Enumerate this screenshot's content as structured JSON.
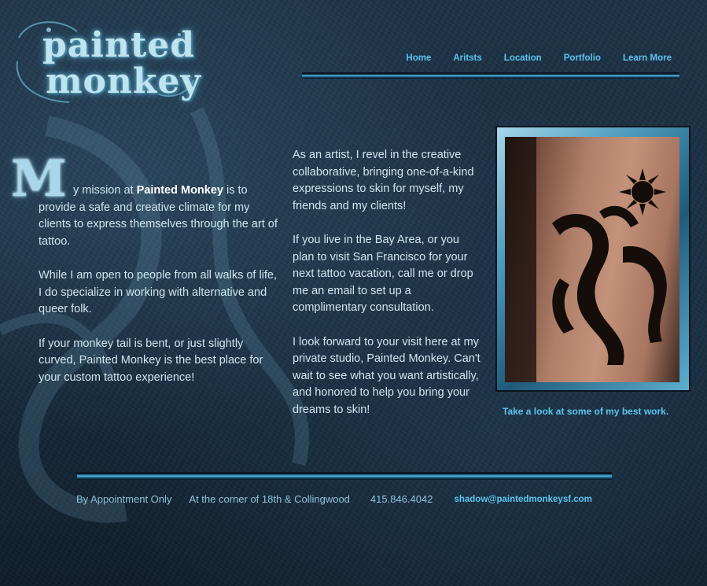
{
  "brand": {
    "logo_line1": "painted",
    "logo_line2": "monkey"
  },
  "nav": {
    "items": [
      "Home",
      "Aritsts",
      "Location",
      "Portfolio",
      "Learn More"
    ]
  },
  "intro": {
    "dropcap": "M",
    "p1_before": "y mission at ",
    "p1_strong": "Painted Monkey",
    "p1_after": " is to provide a safe and creative climate for my clients to express themselves through the art of tattoo.",
    "p2": "While I am open to people from all walks of life, I do specialize in working with alternative and queer folk.",
    "p3": "If your monkey tail is bent, or just slightly curved, Painted Monkey is the best place for your custom tattoo experience!"
  },
  "about": {
    "p1": "As an artist, I revel in the creative collaborative, bringing one-of-a-kind expressions to skin for myself, my friends and my clients!",
    "p2": "If you live in the Bay Area, or you plan to visit San Francisco for your next tattoo vacation, call me or drop me an email to set up a complimentary consultation.",
    "p3": "I look forward to your visit here at my private studio, Painted Monkey. Can't wait to see what you want artistically, and honored to help you bring your dreams to skin!"
  },
  "portfolio": {
    "caption": "Take a look at some of my best work."
  },
  "footer": {
    "appointment": "By Appointment Only",
    "address": "At the corner of 18th & Collingwood",
    "phone": "415.846.4042",
    "email": "shadow@paintedmonkeysf.com"
  }
}
